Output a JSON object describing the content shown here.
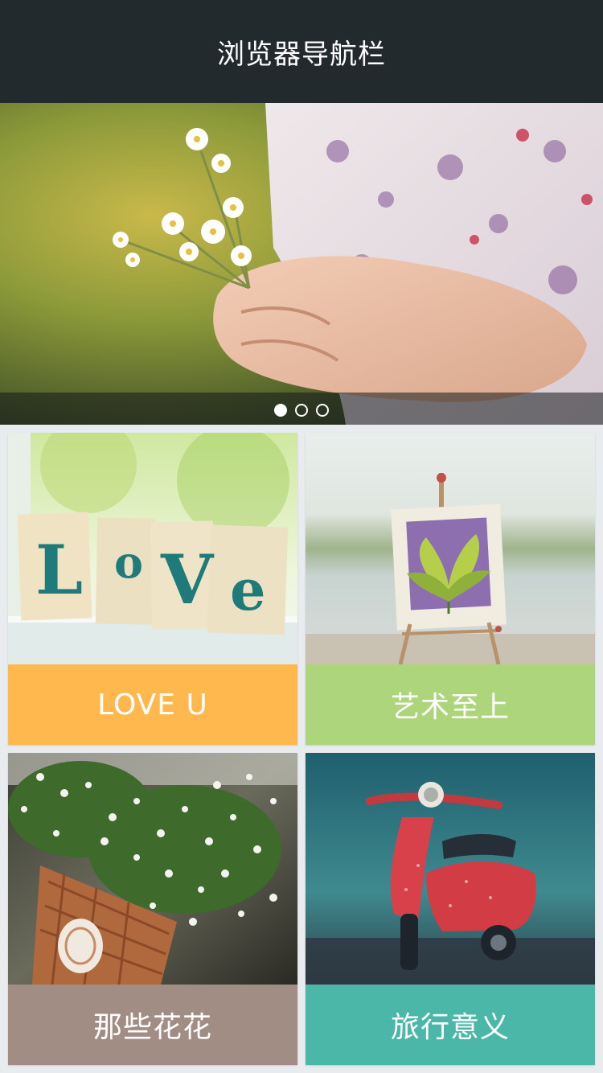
{
  "navbar": {
    "title": "浏览器导航栏"
  },
  "banner": {
    "image_subject": "hands holding bouquet of daisies",
    "slide_count": 3,
    "active_slide": 1
  },
  "cards": [
    {
      "label": "LOVE U",
      "color": "#ffb84d",
      "image_subject": "LOVE letter cards on windowsill",
      "letters": [
        "L",
        "o",
        "V",
        "e"
      ]
    },
    {
      "label": "艺术至上",
      "color": "#acd57c",
      "image_subject": "small easel with leaf painting"
    },
    {
      "label": "那些花花",
      "color": "#a28d84",
      "image_subject": "basket of white baby's breath flowers"
    },
    {
      "label": "旅行意义",
      "color": "#4ab7a8",
      "image_subject": "red toy scooter in rain"
    }
  ]
}
